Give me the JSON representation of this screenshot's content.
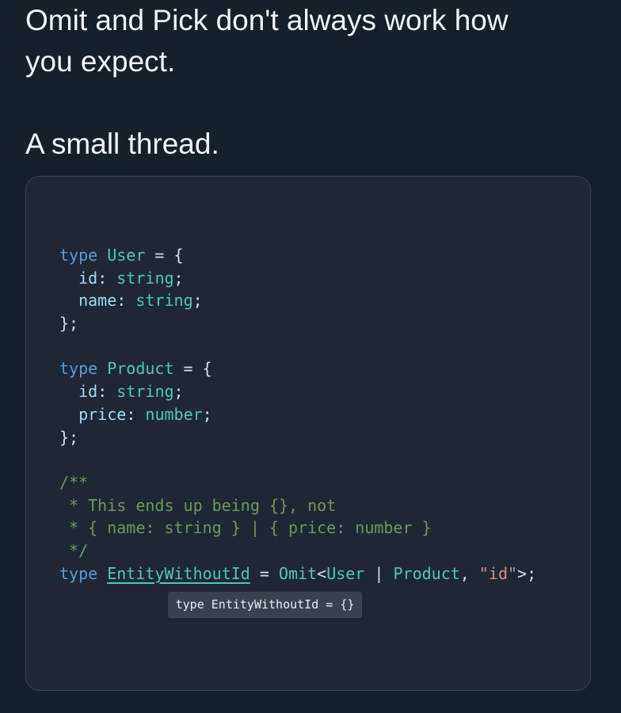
{
  "tweet": {
    "line1": "Omit and Pick don't always work how",
    "line2": "you expect.",
    "line3": "A small thread."
  },
  "code": {
    "l1_kw": "type",
    "l1_name": "User",
    "l1_rest": " = {",
    "l2_prop": "id",
    "l2_type": "string",
    "l3_prop": "name",
    "l3_type": "string",
    "l4": "};",
    "l6_kw": "type",
    "l6_name": "Product",
    "l6_rest": " = {",
    "l7_prop": "id",
    "l7_type": "string",
    "l8_prop": "price",
    "l8_type": "number",
    "l9": "};",
    "c1": "/**",
    "c2": " * This ends up being {}, not",
    "c3": " * { name: string } | { price: number }",
    "c4": " */",
    "last_kw": "type",
    "last_name": "EntityWithoutId",
    "last_eq": " = ",
    "last_omit": "Omit",
    "last_lt": "<",
    "last_user": "User",
    "last_pipe": " | ",
    "last_product": "Product",
    "last_comma": ", ",
    "last_str": "\"id\"",
    "last_end": ">;"
  },
  "tooltip": {
    "text": "type EntityWithoutId = {}"
  }
}
